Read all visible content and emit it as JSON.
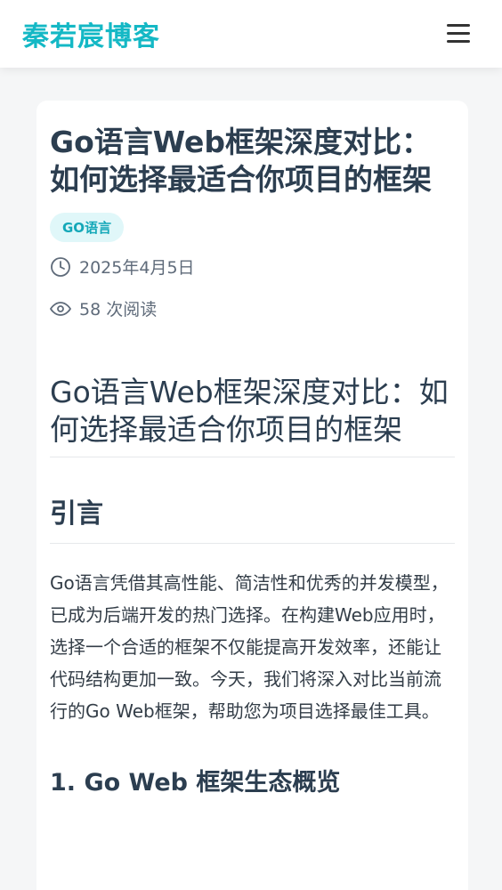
{
  "header": {
    "brand": "秦若宸博客",
    "menu_icon": "hamburger-menu-icon"
  },
  "post": {
    "title": "Go语言Web框架深度对比：如何选择最适合你项目的框架",
    "tag": "GO语言",
    "date": "2025年4月5日",
    "views": "58 次阅读",
    "colors": {
      "accent": "#14b8c5",
      "tag_bg": "#e0f7f9"
    }
  },
  "content": {
    "h1": "Go语言Web框架深度对比：如何选择最适合你项目的框架",
    "intro_heading": "引言",
    "intro_text": "Go语言凭借其高性能、简洁性和优秀的并发模型，已成为后端开发的热门选择。在构建Web应用时，选择一个合适的框架不仅能提高开发效率，还能让代码结构更加一致。今天，我们将深入对比当前流行的Go Web框架，帮助您为项目选择最佳工具。",
    "next_heading": "1. Go Web 框架生态概览"
  }
}
